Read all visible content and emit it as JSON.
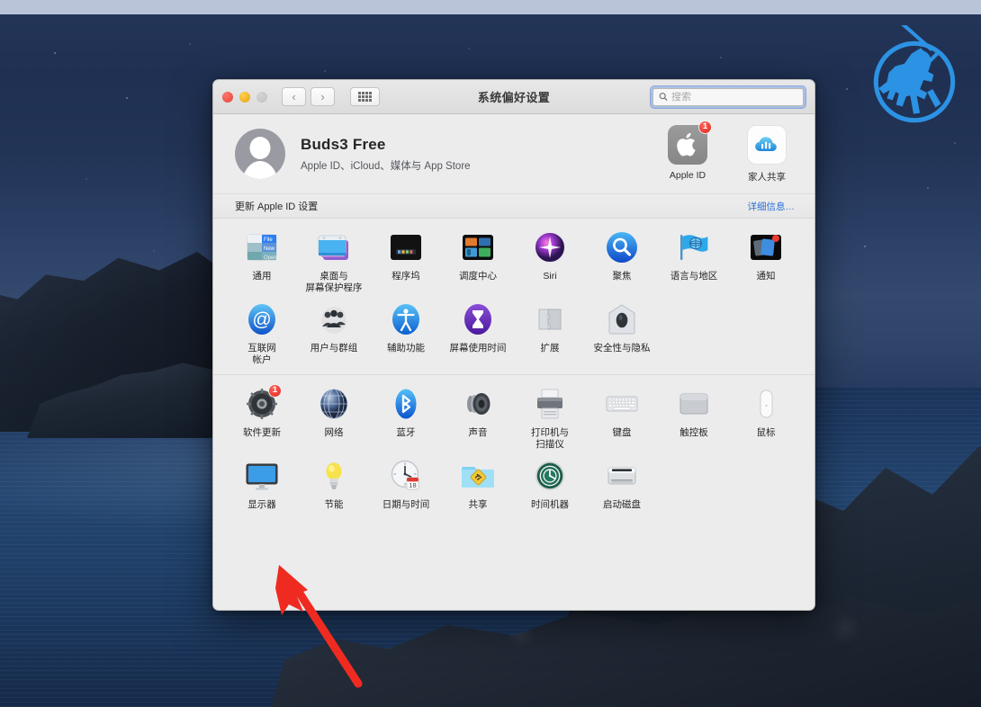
{
  "desktop": {
    "wallpaper_name": "catalina-coast",
    "watermark": {
      "icon": "knight-on-horse-circle-logo",
      "color": "#2e9bf0"
    },
    "menubar_color": "#b9c4d8"
  },
  "window": {
    "title": "系统偏好设置",
    "traffic_lights": [
      {
        "name": "close",
        "color": "#e0443a",
        "enabled": true
      },
      {
        "name": "minimize",
        "color": "#e5a316",
        "enabled": true
      },
      {
        "name": "zoom",
        "color": "#c0c0c0",
        "enabled": false
      }
    ],
    "nav": {
      "back": "‹",
      "forward": "›",
      "show_all_icon": "grid-icon"
    },
    "search": {
      "placeholder": "搜索",
      "value": "",
      "icon": "search-icon",
      "focused": true
    }
  },
  "account": {
    "avatar_icon": "person-avatar-icon",
    "name": "Buds3 Free",
    "subtitle": "Apple ID、iCloud、媒体与 App Store",
    "tiles": [
      {
        "label": "Apple ID",
        "icon": "apple-logo-icon",
        "badge": "1"
      },
      {
        "label": "家人共享",
        "icon": "family-sharing-cloud-icon",
        "badge": ""
      }
    ]
  },
  "update_banner": {
    "text": "更新 Apple ID 设置",
    "link": "详细信息…",
    "link_color": "#2a6fd4"
  },
  "sections": [
    {
      "name": "personal",
      "panes": [
        {
          "label": "通用",
          "icon": "general-icon",
          "badge": ""
        },
        {
          "label": "桌面与\n屏幕保护程序",
          "icon": "desktop-screensaver-icon",
          "badge": ""
        },
        {
          "label": "程序坞",
          "icon": "dock-icon",
          "badge": ""
        },
        {
          "label": "调度中心",
          "icon": "mission-control-icon",
          "badge": ""
        },
        {
          "label": "Siri",
          "icon": "siri-icon",
          "badge": ""
        },
        {
          "label": "聚焦",
          "icon": "spotlight-icon",
          "badge": ""
        },
        {
          "label": "语言与地区",
          "icon": "language-region-flag-icon",
          "badge": ""
        },
        {
          "label": "通知",
          "icon": "notifications-icon",
          "badge": ""
        },
        {
          "label": "互联网\n帐户",
          "icon": "internet-accounts-at-icon",
          "badge": ""
        },
        {
          "label": "用户与群组",
          "icon": "users-groups-icon",
          "badge": ""
        },
        {
          "label": "辅助功能",
          "icon": "accessibility-icon",
          "badge": ""
        },
        {
          "label": "屏幕使用时间",
          "icon": "screen-time-hourglass-icon",
          "badge": ""
        },
        {
          "label": "扩展",
          "icon": "extensions-puzzle-icon",
          "badge": ""
        },
        {
          "label": "安全性与隐私",
          "icon": "security-privacy-house-icon",
          "badge": ""
        }
      ]
    },
    {
      "name": "hardware",
      "panes": [
        {
          "label": "软件更新",
          "icon": "software-update-gear-icon",
          "badge": "1"
        },
        {
          "label": "网络",
          "icon": "network-globe-icon",
          "badge": ""
        },
        {
          "label": "蓝牙",
          "icon": "bluetooth-icon",
          "badge": ""
        },
        {
          "label": "声音",
          "icon": "sound-speaker-icon",
          "badge": ""
        },
        {
          "label": "打印机与\n扫描仪",
          "icon": "printers-scanners-icon",
          "badge": ""
        },
        {
          "label": "键盘",
          "icon": "keyboard-icon",
          "badge": ""
        },
        {
          "label": "触控板",
          "icon": "trackpad-icon",
          "badge": ""
        },
        {
          "label": "鼠标",
          "icon": "mouse-icon",
          "badge": ""
        },
        {
          "label": "显示器",
          "icon": "displays-monitor-icon",
          "badge": ""
        },
        {
          "label": "节能",
          "icon": "energy-saver-bulb-icon",
          "badge": ""
        },
        {
          "label": "日期与时间",
          "icon": "date-time-clock-icon",
          "badge": ""
        },
        {
          "label": "共享",
          "icon": "sharing-folder-icon",
          "badge": ""
        },
        {
          "label": "时间机器",
          "icon": "time-machine-icon",
          "badge": ""
        },
        {
          "label": "启动磁盘",
          "icon": "startup-disk-icon",
          "badge": ""
        }
      ]
    }
  ],
  "annotation": {
    "arrow_color": "#ef2b21",
    "points_to": "显示器"
  }
}
